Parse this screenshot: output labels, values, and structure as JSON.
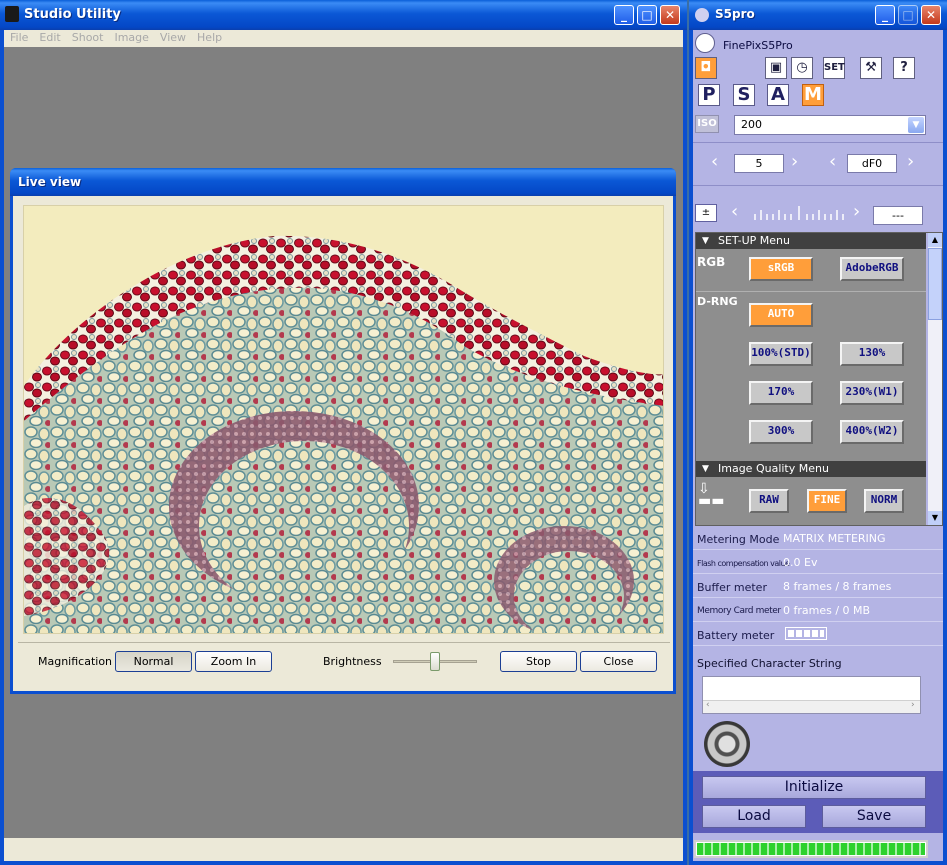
{
  "studio": {
    "title": "Studio Utility",
    "menu": [
      "File",
      "Edit",
      "Shoot",
      "Image",
      "View",
      "Help"
    ]
  },
  "liveview": {
    "title": "Live view",
    "magnification_label": "Magnification",
    "normal_label": "Normal",
    "zoom_in_label": "Zoom In",
    "brightness_label": "Brightness",
    "brightness_level": 0.5,
    "stop_label": "Stop",
    "close_label": "Close"
  },
  "s5": {
    "title": "S5pro",
    "camera_name": "FinePixS5Pro",
    "icon_labels": {
      "set": "SET",
      "help": "?"
    },
    "modes": [
      "P",
      "S",
      "A",
      "M"
    ],
    "active_mode": "M",
    "iso_label": "ISO",
    "iso_value": "200",
    "shutter_value": "5",
    "aperture_value": "dF0",
    "exposure_value": "---",
    "setup_menu_title": "SET-UP Menu",
    "rgb_label": "RGB",
    "srgb_label": "sRGB",
    "adobergb_label": "AdobeRGB",
    "drng_label": "D-RNG",
    "drng_options": [
      "AUTO",
      "100%(STD)",
      "130%",
      "170%",
      "230%(W1)",
      "300%",
      "400%(W2)"
    ],
    "quality_menu_title": "Image Quality Menu",
    "quality_options": [
      "RAW",
      "FINE",
      "NORM"
    ],
    "info": [
      {
        "label": "Metering Mode",
        "value": "MATRIX METERING"
      },
      {
        "label": "Flash compensation value",
        "value": "0.0 Ev"
      },
      {
        "label": "Buffer meter",
        "value": "8 frames / 8 frames"
      },
      {
        "label": "Memory Card meter",
        "value": "0 frames / 0 MB"
      },
      {
        "label": "Battery meter",
        "value": ""
      }
    ],
    "battery_level": 1.0,
    "char_string_label": "Specified Character String",
    "char_string_value": "",
    "initialize_label": "Initialize",
    "load_label": "Load",
    "save_label": "Save",
    "progress_level": 1.0
  }
}
